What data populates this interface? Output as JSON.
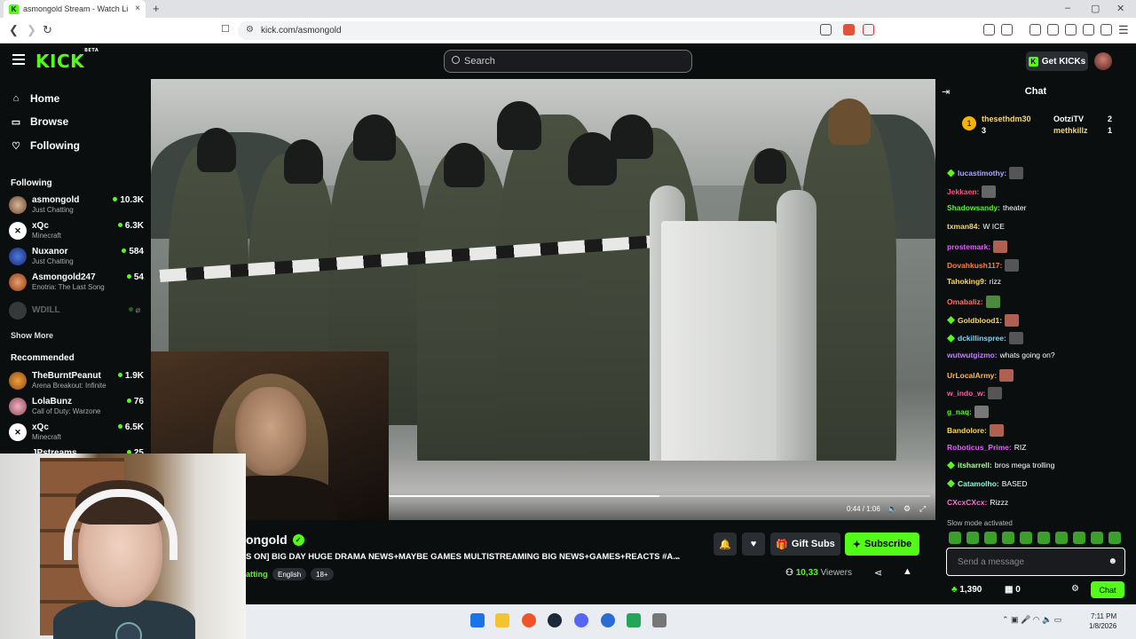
{
  "browser": {
    "tab_title": "asmongold Stream - Watch Li",
    "favicon_letter": "K",
    "close_symbol": "×",
    "new_tab_symbol": "+",
    "url": "kick.com/asmongold",
    "window_controls": [
      "–",
      "▢",
      "✕"
    ]
  },
  "header": {
    "logo": "KICK",
    "logo_badge": "BETA",
    "search_placeholder": "Search",
    "get_kicks_label": "Get KICKs"
  },
  "sidebar": {
    "nav": [
      {
        "icon": "home-icon",
        "label": "Home"
      },
      {
        "icon": "browse-icon",
        "label": "Browse"
      },
      {
        "icon": "heart-icon",
        "label": "Following"
      }
    ],
    "following_title": "Following",
    "following": [
      {
        "name": "asmongold",
        "category": "Just Chatting",
        "viewers": "10.3K"
      },
      {
        "name": "xQc",
        "category": "Minecraft",
        "viewers": "6.3K"
      },
      {
        "name": "Nuxanor",
        "category": "Just Chatting",
        "viewers": "584"
      },
      {
        "name": "Asmongold247",
        "category": "Enotria: The Last Song",
        "viewers": "54"
      },
      {
        "name": "WDILL",
        "category": "",
        "viewers": ""
      }
    ],
    "show_more": "Show More",
    "recommended_title": "Recommended",
    "recommended": [
      {
        "name": "TheBurntPeanut",
        "category": "Arena Breakout: Infinite",
        "viewers": "1.9K"
      },
      {
        "name": "LolaBunz",
        "category": "Call of Duty: Warzone",
        "viewers": "76"
      },
      {
        "name": "xQc",
        "category": "Minecraft",
        "viewers": "6.5K"
      },
      {
        "name": "JPstreams",
        "category": "",
        "viewers": "25"
      }
    ]
  },
  "player": {
    "time": "0:44 / 1:06",
    "progress": 0.5
  },
  "stream": {
    "name": "ongold",
    "title": "S ON] BIG DAY HUGE DRAMA NEWS+MAYBE GAMES MULTISTREAMING BIG NEWS+GAMES+REACTS #A...",
    "category": "atting",
    "tags": [
      "English",
      "18+"
    ],
    "viewers_count": "10,3",
    "viewers_count_tail": "3",
    "viewers_label": "Viewers",
    "gift_subs_label": "Gift Subs",
    "subscribe_label": "Subscribe"
  },
  "chat": {
    "title": "Chat",
    "pinned": [
      {
        "name": "thesethdm30",
        "count": "3"
      },
      {
        "name": "OotziTV",
        "count": "2"
      },
      {
        "name": "methkillz",
        "count": "1"
      }
    ],
    "messages": [
      {
        "user": "lucastimothy:",
        "text": "",
        "color": "#a6a9ff",
        "badge": true,
        "emote": "#555"
      },
      {
        "user": "Jekkaen:",
        "text": "",
        "color": "#ff4f7d",
        "badge": false,
        "emote": "#666"
      },
      {
        "user": "Shadowsandy:",
        "text": "theater",
        "color": "#53fc18",
        "badge": false,
        "emote": ""
      },
      {
        "user": "txman84:",
        "text": "W ICE",
        "color": "#f5d76e",
        "badge": false,
        "emote": ""
      },
      {
        "user": "prostemark:",
        "text": "",
        "color": "#e95cff",
        "badge": false,
        "emote": "#b06050"
      },
      {
        "user": "Dovahkush117:",
        "text": "",
        "color": "#ff7f3f",
        "badge": false,
        "emote": "#555"
      },
      {
        "user": "Tahoking9:",
        "text": "rizz",
        "color": "#ffd84f",
        "badge": false,
        "emote": ""
      },
      {
        "user": "Omabaliz:",
        "text": "",
        "color": "#ff6f6f",
        "badge": false,
        "emote": "#4a8a3a"
      },
      {
        "user": "Goldblood1:",
        "text": "",
        "color": "#f5d76e",
        "badge": true,
        "emote": "#b06050"
      },
      {
        "user": "dckillinspree:",
        "text": "",
        "color": "#7fd7ff",
        "badge": true,
        "emote": "#555"
      },
      {
        "user": "wutwutgizmo:",
        "text": "whats going on?",
        "color": "#c77dff",
        "badge": false,
        "emote": ""
      },
      {
        "user": "UrLocalArmy:",
        "text": "",
        "color": "#ffb84f",
        "badge": false,
        "emote": "#b06050"
      },
      {
        "user": "w_indo_w:",
        "text": "",
        "color": "#ff5ca8",
        "badge": false,
        "emote": "#555"
      },
      {
        "user": "g_naq:",
        "text": "",
        "color": "#53fc18",
        "badge": false,
        "emote": "#777"
      },
      {
        "user": "Bandolore:",
        "text": "",
        "color": "#ffd84f",
        "badge": false,
        "emote": "#b06050"
      },
      {
        "user": "Roboticus_Prime:",
        "text": "RIZ",
        "color": "#e95cff",
        "badge": false,
        "emote": ""
      },
      {
        "user": "itsharrell:",
        "text": "bros mega trolling",
        "color": "#a6ff8f",
        "badge": true,
        "emote": ""
      },
      {
        "user": "Catamolho:",
        "text": "BASED",
        "color": "#7fffd4",
        "badge": true,
        "emote": ""
      },
      {
        "user": "CXcxCXcx:",
        "text": "Rizzz",
        "color": "#ff6fd0",
        "badge": false,
        "emote": ""
      }
    ],
    "slow_mode": "Slow mode activated",
    "input_placeholder": "Send a message",
    "points": "1,390",
    "points2": "0",
    "send_label": "Chat"
  },
  "taskbar": {
    "time": "7:11 PM",
    "date": "1/8/2026"
  },
  "colors": {
    "accent": "#53fc18",
    "bg": "#0b0e0f"
  }
}
